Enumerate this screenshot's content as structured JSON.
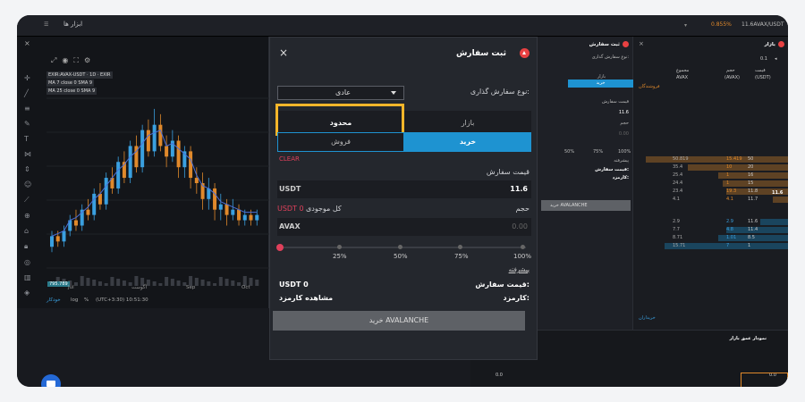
{
  "topbar": {
    "menu_label": "ابزار ها",
    "pct_change": "0.855%",
    "pair_label": "11.6AVAX/USDT"
  },
  "chart": {
    "legend_main": "EXIR:AVAX-USDT · 1D · EXIR",
    "legend_ma7": "MA 7 close 0 SMA 9",
    "legend_ma25": "MA 25 close 0 SMA 9",
    "x_labels": [
      "Jul",
      "آگوست",
      "Sep",
      "Oct"
    ],
    "price_badge": "795.789",
    "bottom_auto": "خودکار",
    "bottom_log": "log",
    "bottom_pct": "%",
    "bottom_time": "(UTC+3:30) 10:51:30",
    "candles": [
      {
        "o": 4,
        "c": 6,
        "h": 7,
        "l": 3
      },
      {
        "o": 6,
        "c": 5,
        "h": 7,
        "l": 4
      },
      {
        "o": 5,
        "c": 7,
        "h": 8,
        "l": 4
      },
      {
        "o": 7,
        "c": 9,
        "h": 10,
        "l": 6
      },
      {
        "o": 9,
        "c": 8,
        "h": 11,
        "l": 7
      },
      {
        "o": 8,
        "c": 11,
        "h": 12,
        "l": 7
      },
      {
        "o": 11,
        "c": 10,
        "h": 13,
        "l": 9
      },
      {
        "o": 10,
        "c": 14,
        "h": 15,
        "l": 9
      },
      {
        "o": 14,
        "c": 12,
        "h": 16,
        "l": 11
      },
      {
        "o": 12,
        "c": 17,
        "h": 18,
        "l": 11
      },
      {
        "o": 17,
        "c": 15,
        "h": 19,
        "l": 14
      },
      {
        "o": 15,
        "c": 20,
        "h": 21,
        "l": 14
      },
      {
        "o": 20,
        "c": 17,
        "h": 22,
        "l": 16
      },
      {
        "o": 17,
        "c": 23,
        "h": 24,
        "l": 16
      },
      {
        "o": 23,
        "c": 19,
        "h": 25,
        "l": 18
      },
      {
        "o": 19,
        "c": 26,
        "h": 27,
        "l": 18
      },
      {
        "o": 26,
        "c": 22,
        "h": 28,
        "l": 21
      },
      {
        "o": 22,
        "c": 27,
        "h": 30,
        "l": 21
      },
      {
        "o": 27,
        "c": 23,
        "h": 29,
        "l": 22
      },
      {
        "o": 23,
        "c": 21,
        "h": 25,
        "l": 19
      },
      {
        "o": 21,
        "c": 24,
        "h": 26,
        "l": 20
      },
      {
        "o": 24,
        "c": 19,
        "h": 25,
        "l": 17
      },
      {
        "o": 19,
        "c": 22,
        "h": 23,
        "l": 17
      },
      {
        "o": 22,
        "c": 17,
        "h": 23,
        "l": 15
      },
      {
        "o": 17,
        "c": 16,
        "h": 19,
        "l": 14
      },
      {
        "o": 16,
        "c": 13,
        "h": 18,
        "l": 11
      },
      {
        "o": 13,
        "c": 15,
        "h": 17,
        "l": 11
      },
      {
        "o": 15,
        "c": 11,
        "h": 16,
        "l": 9
      },
      {
        "o": 11,
        "c": 12,
        "h": 14,
        "l": 9
      },
      {
        "o": 12,
        "c": 10,
        "h": 13,
        "l": 8
      },
      {
        "o": 10,
        "c": 11,
        "h": 13,
        "l": 9
      },
      {
        "o": 11,
        "c": 9,
        "h": 12,
        "l": 8
      },
      {
        "o": 9,
        "c": 10,
        "h": 11,
        "l": 8
      },
      {
        "o": 10,
        "c": 9,
        "h": 11,
        "l": 8
      },
      {
        "o": 9,
        "c": 10,
        "h": 11,
        "l": 8
      }
    ]
  },
  "modal": {
    "title": "ثبت سفارش",
    "order_type_label": "نوع سفارش گذاری:",
    "order_type_value": "عادی",
    "tab_market": "بازار",
    "tab_limit": "محدود",
    "side_buy": "خرید",
    "side_sell": "فروش",
    "clear": "CLEAR",
    "price_label": "قیمت سفارش",
    "price_unit": "USDT",
    "price_value": "11.6",
    "volume_label": "حجم",
    "balance_label": "کل موجودی",
    "balance_value": "USDT 0",
    "amount_unit": "AVAX",
    "amount_placeholder": "0.00",
    "ticks": [
      "25%",
      "50%",
      "75%",
      "100%"
    ],
    "advanced": "پیشرفته",
    "order_price_label": "قیمت سفارش:",
    "order_price_value": "USDT 0",
    "fee_label": "کارمزد:",
    "fee_value": "مشاهده کارمزد",
    "submit": "خرید AVALANCHE"
  },
  "trade_panel": {
    "title": "ثبت سفارش",
    "order_type": "نوع سفارش گذاری:",
    "tab_market": "بازار",
    "tab_buy": "خرید",
    "price_label": "قیمت سفارش",
    "price_value": "11.6",
    "volume_label": "حجم",
    "volume_value": "0.00",
    "ticks": [
      "50%",
      "75%",
      "100%"
    ],
    "advanced": "پیشرفته",
    "order_price": "قیمت سفارش:",
    "fee": "کارمزد:",
    "submit": "خرید AVALANCHE"
  },
  "orderbook": {
    "title": "بازار",
    "precision": "0.1",
    "col_total": "مجموع",
    "col_volume": "حجم",
    "col_price": "قیمت",
    "col_total_unit": "AVAX",
    "col_volume_unit": "(AVAX)",
    "col_price_unit": "(USDT)",
    "sellers": "فروشندگان",
    "buyers": "خریداران",
    "mid_price": "11.6",
    "asks": [
      {
        "total": "50.819",
        "vol": "15.419",
        "price": "50",
        "fill": 0.92
      },
      {
        "total": "35.4",
        "vol": "10",
        "price": "20",
        "fill": 0.65
      },
      {
        "total": "25.4",
        "vol": "1",
        "price": "16",
        "fill": 0.45
      },
      {
        "total": "24.4",
        "vol": "1",
        "price": "15",
        "fill": 0.42
      },
      {
        "total": "23.4",
        "vol": "19.3",
        "price": "11.8",
        "fill": 0.4
      },
      {
        "total": "4.1",
        "vol": "4.1",
        "price": "11.7",
        "fill": 0.1
      }
    ],
    "bids": [
      {
        "total": "2.9",
        "vol": "2.9",
        "price": "11.6",
        "fill": 0.18
      },
      {
        "total": "7.7",
        "vol": "4.8",
        "price": "11.4",
        "fill": 0.4
      },
      {
        "total": "8.71",
        "vol": "1.01",
        "price": "8.5",
        "fill": 0.45
      },
      {
        "total": "15.71",
        "vol": "7",
        "price": "1",
        "fill": 0.8
      }
    ]
  },
  "depth": {
    "title": "نمودار عمق بازار",
    "axis": [
      "0.0",
      "0.0"
    ]
  }
}
